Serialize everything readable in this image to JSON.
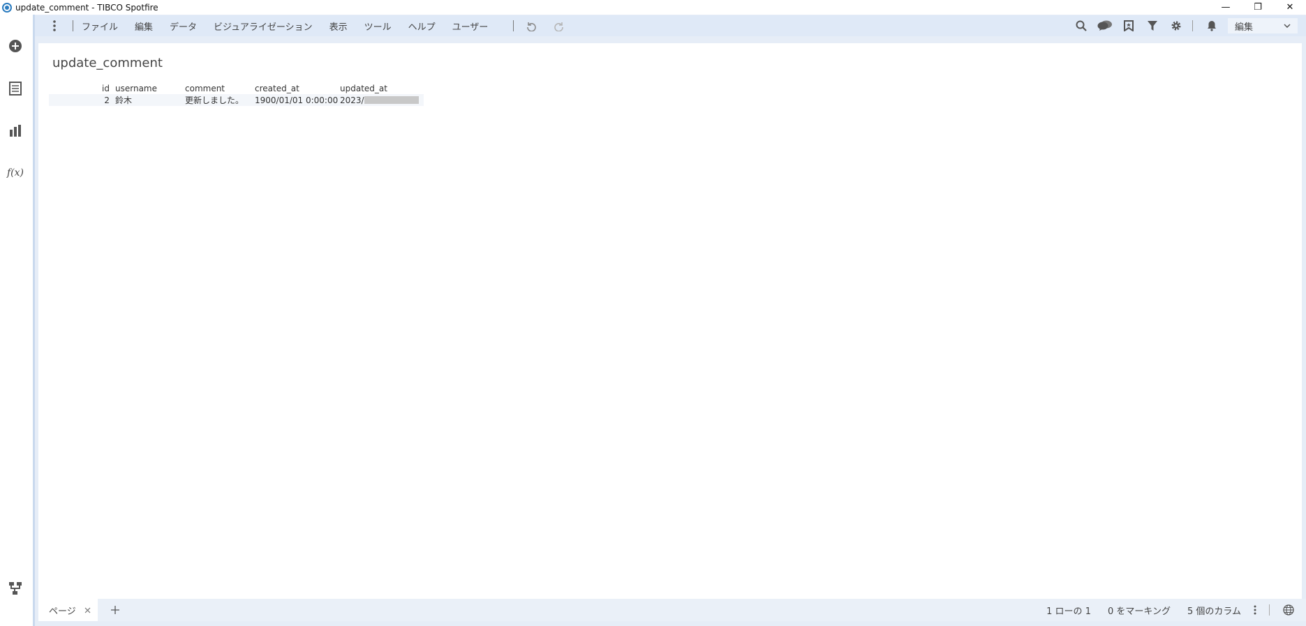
{
  "window": {
    "title": "update_comment - TIBCO Spotfire",
    "minimize": "—",
    "restore": "❐",
    "close": "✕"
  },
  "menu": {
    "items": [
      "ファイル",
      "編集",
      "データ",
      "ビジュアライゼーション",
      "表示",
      "ツール",
      "ヘルプ",
      "ユーザー"
    ],
    "mode": "編集"
  },
  "visualization": {
    "title": "update_comment",
    "columns": [
      "id",
      "username",
      "comment",
      "created_at",
      "updated_at"
    ],
    "rows": [
      {
        "id": "2",
        "username": "鈴木",
        "comment": "更新しました。",
        "created_at": "1900/01/01 0:00:00",
        "updated_at": "2023/"
      }
    ]
  },
  "bottom": {
    "page_tab": "ページ",
    "status_rows": "1 ローの 1",
    "status_marked": "0 をマーキング",
    "status_columns": "5 個のカラム"
  },
  "icons": {
    "rail": [
      "add-icon",
      "data-table-icon",
      "bar-chart-icon",
      "function-icon",
      "data-canvas-icon"
    ],
    "toolbar": [
      "search-icon",
      "comments-icon",
      "bookmark-icon",
      "filter-icon",
      "settings-icon",
      "notification-icon",
      "globe-icon"
    ]
  }
}
